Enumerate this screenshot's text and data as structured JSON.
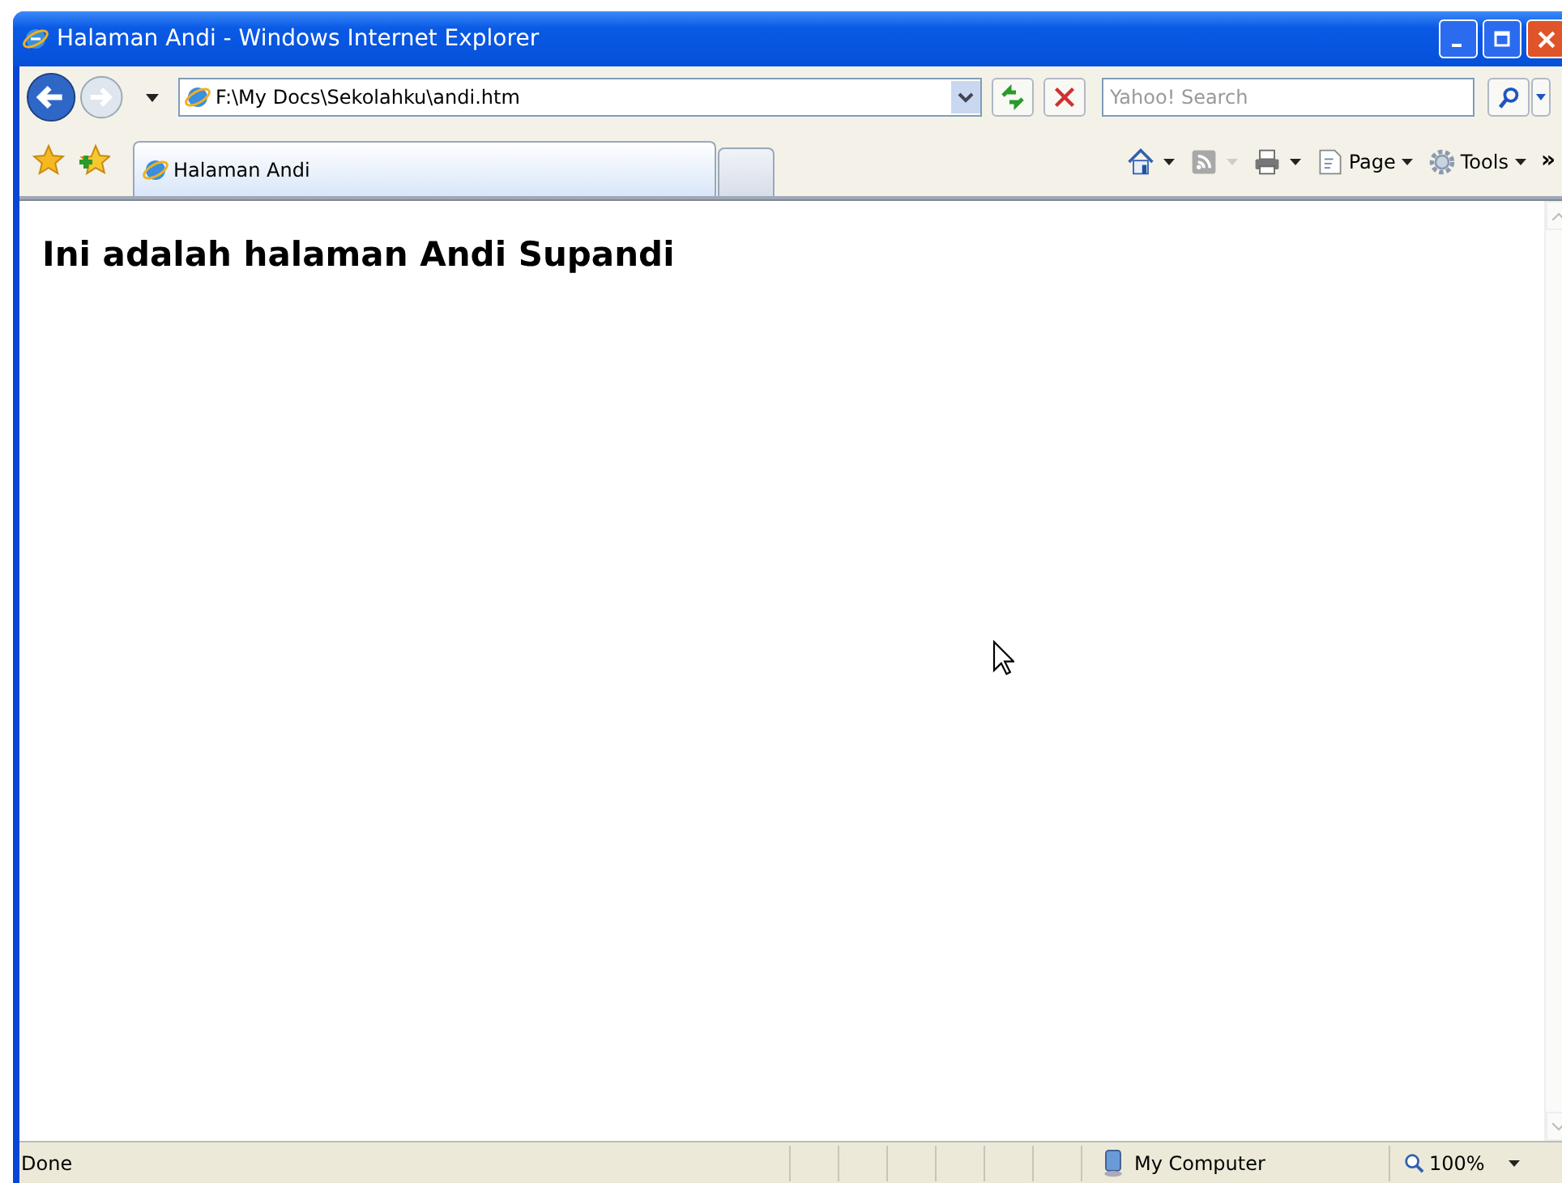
{
  "window": {
    "title": "Halaman Andi - Windows Internet Explorer"
  },
  "address_bar": {
    "value": "F:\\My Docs\\Sekolahku\\andi.htm"
  },
  "search": {
    "placeholder": "Yahoo! Search"
  },
  "tabs": [
    {
      "label": "Halaman Andi",
      "selected": true
    }
  ],
  "command_bar": {
    "items": [
      {
        "label": "Page"
      },
      {
        "label": "Tools"
      }
    ],
    "overflow": "»"
  },
  "page": {
    "heading": "Ini adalah halaman Andi Supandi"
  },
  "status_bar": {
    "status": "Done",
    "zone": "My Computer",
    "zoom": "100%"
  }
}
